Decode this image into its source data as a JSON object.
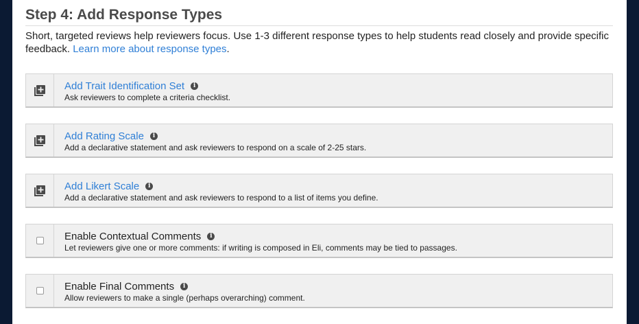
{
  "step": {
    "heading": "Step 4: Add Response Types",
    "intro": "Short, targeted reviews help reviewers focus. Use 1-3 different response types to help students read closely and provide specific feedback.",
    "learn_more_label": "Learn more about response types",
    "learn_more_trailing": "."
  },
  "options": [
    {
      "title": "Add Trait Identification Set",
      "description": "Ask reviewers to complete a criteria checklist.",
      "control": "add-icon",
      "info_icon": "info-icon"
    },
    {
      "title": "Add Rating Scale",
      "description": "Add a declarative statement and ask reviewers to respond on a scale of 2-25 stars.",
      "control": "add-icon",
      "info_icon": "info-icon"
    },
    {
      "title": "Add Likert Scale",
      "description": "Add a declarative statement and ask reviewers to respond to a list of items you define.",
      "control": "add-icon",
      "info_icon": "info-icon"
    },
    {
      "title": "Enable Contextual Comments",
      "description": "Let reviewers give one or more comments: if writing is composed in Eli, comments may be tied to passages.",
      "control": "checkbox",
      "checked": false,
      "info_icon": "info-icon"
    },
    {
      "title": "Enable Final Comments",
      "description": "Allow reviewers to make a single (perhaps overarching) comment.",
      "control": "checkbox",
      "checked": false,
      "info_icon": "info-icon"
    }
  ],
  "colors": {
    "link": "#2f7fd6",
    "heading": "#4a4a4a",
    "card_bg": "#f0f0f0",
    "page_bg": "#0b1a33"
  }
}
